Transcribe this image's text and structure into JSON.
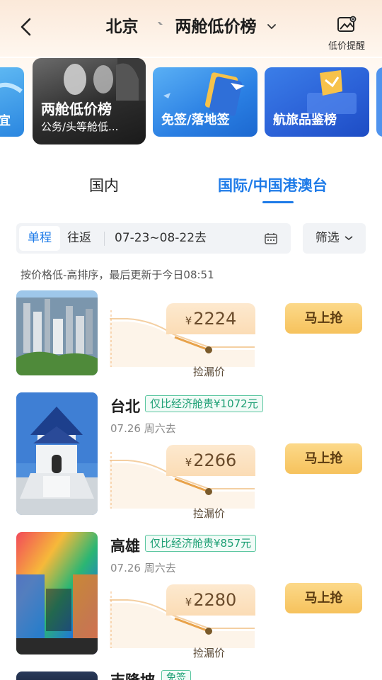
{
  "header": {
    "origin": "北京",
    "title": "两舱低价榜",
    "alert_label": "低价提醒"
  },
  "categories": [
    {
      "label": "宜"
    },
    {
      "title": "两舱低价榜",
      "subtitle": "公务/头等舱低..."
    },
    {
      "label": "免签/落地签"
    },
    {
      "label": "航旅品鉴榜"
    }
  ],
  "tabs": {
    "domestic": "国内",
    "international": "国际/中国港澳台"
  },
  "filter": {
    "one_way": "单程",
    "round_trip": "往返",
    "date_range": "07-23~08-22去",
    "filter_label": "筛选"
  },
  "sort_note": "按价格低-高排序，最后更新于今日08:51",
  "items": [
    {
      "price": "2224",
      "price_label": "捡漏价",
      "button": "马上抢"
    },
    {
      "city": "台北",
      "badge": "仅比经济舱贵¥1072元",
      "date": "07.26 周六去",
      "price": "2266",
      "price_label": "捡漏价",
      "button": "马上抢"
    },
    {
      "city": "高雄",
      "badge": "仅比经济舱贵¥857元",
      "date": "07.26 周六去",
      "price": "2280",
      "price_label": "捡漏价",
      "button": "马上抢"
    }
  ],
  "partial_item": {
    "city": "吉隆坡",
    "badge": "免签"
  },
  "colors": {
    "accent": "#1e7be8",
    "badge_green": "#1d9f74",
    "button_gold": "#f6c25c"
  }
}
